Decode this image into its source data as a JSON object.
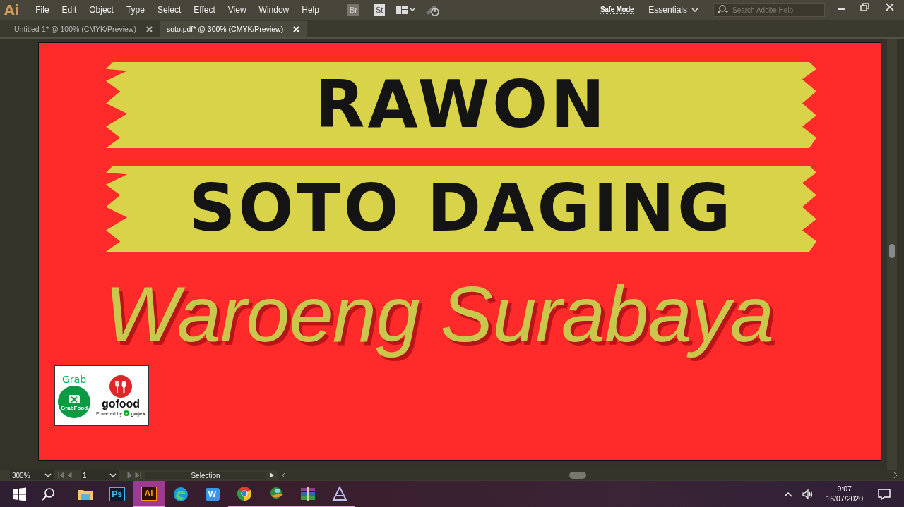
{
  "app": {
    "logo": "Ai"
  },
  "menu": [
    "File",
    "Edit",
    "Object",
    "Type",
    "Select",
    "Effect",
    "View",
    "Window",
    "Help"
  ],
  "toolbar": {
    "bridge": "Br",
    "stock": "St"
  },
  "workspace": {
    "safe_mode": "Safe Mode",
    "name": "Essentials"
  },
  "search": {
    "placeholder": "Search Adobe Help"
  },
  "tabs": [
    {
      "label": "Untitled-1* @ 100% (CMYK/Preview)",
      "selected": false
    },
    {
      "label": "soto.pdf* @ 300% (CMYK/Preview)",
      "selected": true
    }
  ],
  "artboard": {
    "banners": [
      "RAWON",
      "SOTO DAGING"
    ],
    "title": "Waroeng Surabaya",
    "logos": {
      "grab": "Grab",
      "grabfood": "GrabFood",
      "gofood": "gofood",
      "powered_by": "Powered by",
      "gojek": "gojek"
    }
  },
  "status_bar": {
    "zoom": "300%",
    "page": "1",
    "tool": "Selection"
  },
  "taskbar": {
    "apps": [
      {
        "kind": "folder",
        "selected": false,
        "running": false
      },
      {
        "kind": "ps",
        "label": "Ps",
        "selected": false,
        "running": false
      },
      {
        "kind": "ai",
        "label": "Ai",
        "selected": true,
        "running": true
      },
      {
        "kind": "edge",
        "selected": false,
        "running": false
      },
      {
        "kind": "wps",
        "label": "W",
        "selected": false,
        "running": false
      },
      {
        "kind": "chrome",
        "selected": false,
        "running": true
      },
      {
        "kind": "globe",
        "selected": false,
        "running": true
      },
      {
        "kind": "books",
        "selected": false,
        "running": true
      },
      {
        "kind": "triangle",
        "selected": false,
        "running": true
      }
    ],
    "time": "9:07",
    "date": "16/07/2020"
  }
}
